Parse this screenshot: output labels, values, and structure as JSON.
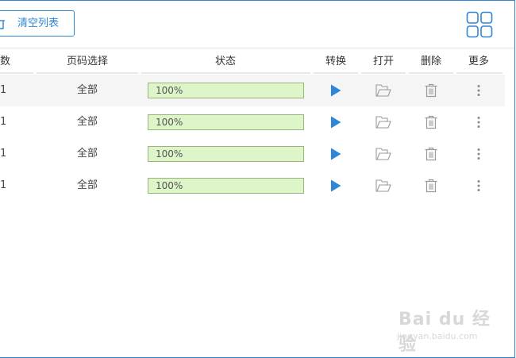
{
  "toolbar": {
    "clear_list_label": "清空列表",
    "clear_icon": "trash-icon",
    "view_toggle_icon": "grid-view-icon"
  },
  "table": {
    "headers": {
      "pages": "数",
      "page_select": "页码选择",
      "status": "状态",
      "convert": "转换",
      "open": "打开",
      "delete": "删除",
      "more": "更多"
    },
    "rows": [
      {
        "pages": "1",
        "page_select": "全部",
        "progress_label": "100%",
        "progress": 1.0
      },
      {
        "pages": "1",
        "page_select": "全部",
        "progress_label": "100%",
        "progress": 1.0
      },
      {
        "pages": "1",
        "page_select": "全部",
        "progress_label": "100%",
        "progress": 1.0
      },
      {
        "pages": "1",
        "page_select": "全部",
        "progress_label": "100%",
        "progress": 1.0
      }
    ]
  },
  "icons": {
    "convert": "play-icon",
    "open": "folder-open-icon",
    "delete": "trash-icon",
    "more": "more-vertical-icon"
  },
  "colors": {
    "accent": "#2f86d6",
    "progress_fill": "#ddf5c8",
    "progress_border": "#99b57a",
    "icon_gray": "#9a9a9a",
    "row_alt": "#f5f5f5"
  },
  "watermark": {
    "main": "Bai du 经验",
    "sub": "jingyan.baidu.com"
  }
}
